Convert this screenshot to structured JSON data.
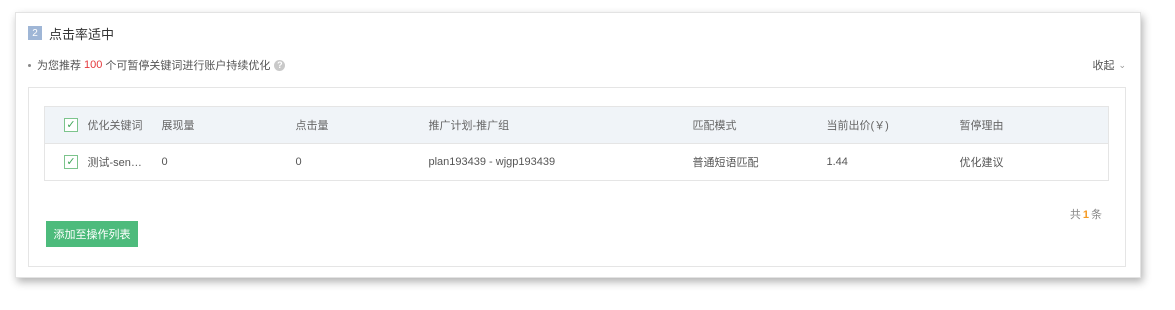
{
  "section": {
    "number": "2",
    "title": "点击率适中",
    "tip_prefix": "为您推荐",
    "tip_count": "100",
    "tip_suffix": "个可暂停关键词进行账户持续优化",
    "help_glyph": "?",
    "collapse_label": "收起",
    "collapse_glyph": "⌄"
  },
  "table": {
    "headers": [
      "优化关键词",
      "展现量",
      "点击量",
      "推广计划-推广组",
      "匹配模式",
      "当前出价(￥)",
      "暂停理由"
    ],
    "rows": [
      {
        "checked": true,
        "keyword": "测试-sen…",
        "impressions": "0",
        "clicks": "0",
        "plan_group": "plan193439 - wjgp193439",
        "match_mode": "普通短语匹配",
        "bid": "1.44",
        "reason": "优化建议"
      }
    ]
  },
  "pagination": {
    "prefix": "共",
    "count": "1",
    "suffix": "条"
  },
  "actions": {
    "add_label": "添加至操作列表"
  },
  "colors": {
    "accent_green": "#4dbb7c",
    "count_red": "#e4393c",
    "total_orange": "#f59a23",
    "header_bg": "#f0f4f8"
  }
}
